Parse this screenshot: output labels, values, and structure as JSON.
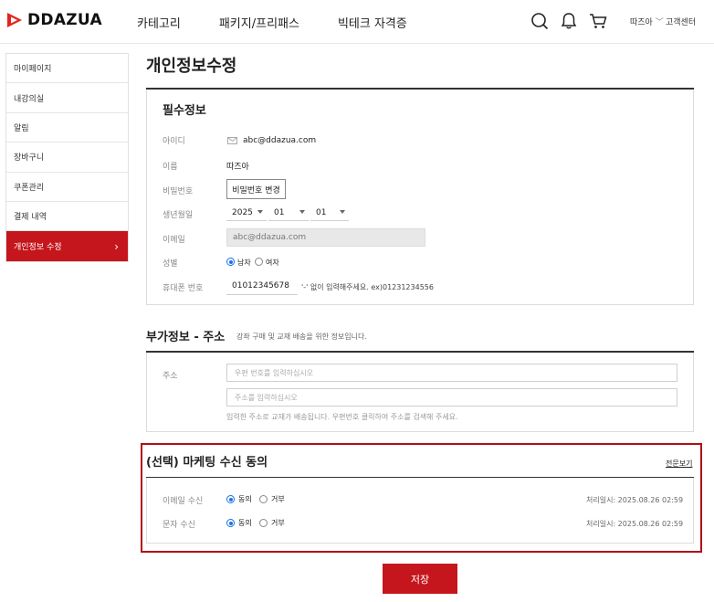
{
  "header": {
    "logo_text": "DDAZUA",
    "nav": [
      "카테고리",
      "패키지/프리패스",
      "빅테크 자격증"
    ],
    "user_name": "따즈아",
    "user_caret": "﹀",
    "help": "고객센터",
    "brand_color": "#c4161c"
  },
  "sidebar": {
    "items": [
      {
        "label": "마이페이지"
      },
      {
        "label": "내강의실"
      },
      {
        "label": "알림"
      },
      {
        "label": "장바구니"
      },
      {
        "label": "쿠폰관리"
      },
      {
        "label": "결제 내역"
      },
      {
        "label": "개인정보 수정"
      }
    ],
    "active_arrow": "›"
  },
  "page": {
    "title": "개인정보수정"
  },
  "required": {
    "title": "필수정보",
    "id_label": "아이디",
    "id_value": "abc@ddazua.com",
    "name_label": "이름",
    "name_value": "따즈아",
    "password_label": "비밀번호",
    "password_button": "비밀번호 변경",
    "birth_label": "생년월일",
    "birth_year": "2025",
    "birth_month": "01",
    "birth_day": "01",
    "email_label": "이메일",
    "email_value": "abc@ddazua.com",
    "gender_label": "성별",
    "gender_male": "남자",
    "gender_female": "여자",
    "gender_selected": "남자",
    "phone_label": "휴대폰 번호",
    "phone_value": "01012345678",
    "phone_hint": "'-' 없이 입력해주세요. ex)01231234556"
  },
  "additional": {
    "title": "부가정보 - 주소",
    "subtitle": "강좌 구매 및 교재 배송을 위한 정보입니다.",
    "address_label": "주소",
    "postcode_placeholder": "우편 번호를 입력하십시오",
    "address_placeholder": "주소를 입력하십시오",
    "address_hint": "입력한 주소로 교재가 배송됩니다. 우편번호 클릭하여 주소를 검색해 주세요."
  },
  "marketing": {
    "title": "(선택) 마케팅 수신 동의",
    "view_full": "전문보기",
    "rows": [
      {
        "label": "이메일 수신",
        "agree": "동의",
        "decline": "거부",
        "selected": "동의",
        "processed": "처리일시: 2025.08.26 02:59"
      },
      {
        "label": "문자 수신",
        "agree": "동의",
        "decline": "거부",
        "selected": "동의",
        "processed": "처리일시: 2025.08.26 02:59"
      }
    ]
  },
  "actions": {
    "save": "저장"
  }
}
